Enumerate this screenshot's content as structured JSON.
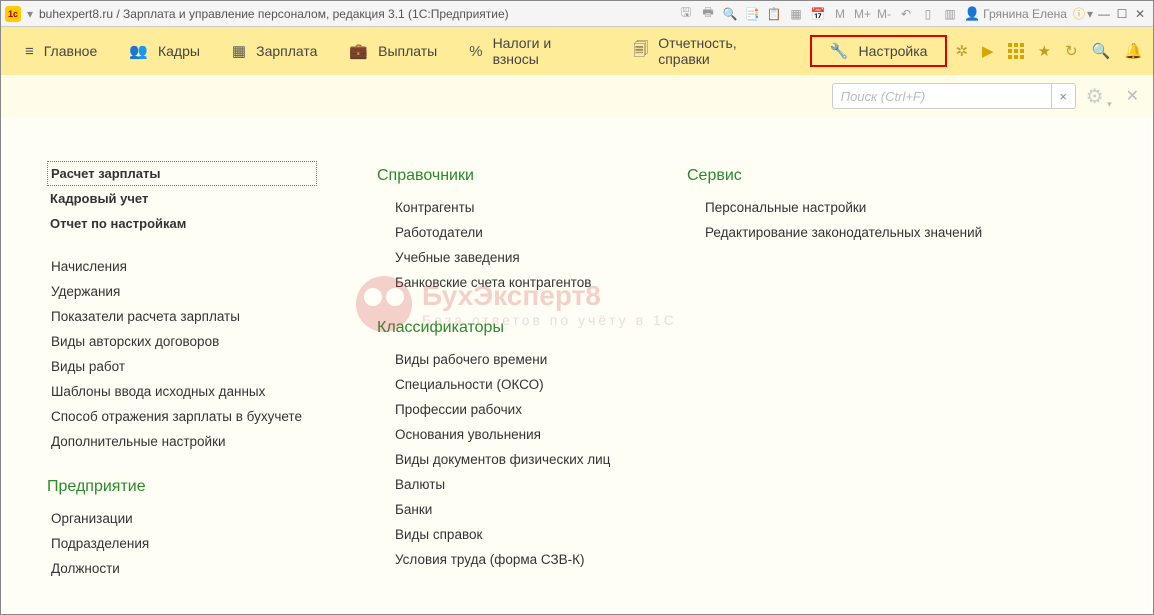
{
  "title": "buhexpert8.ru / Зарплата и управление персоналом, редакция 3.1  (1С:Предприятие)",
  "user": "Грянина Елена",
  "nav": [
    {
      "icon": "≡",
      "label": "Главное"
    },
    {
      "icon": "👥",
      "label": "Кадры"
    },
    {
      "icon": "▦",
      "label": "Зарплата"
    },
    {
      "icon": "💼",
      "label": "Выплаты"
    },
    {
      "icon": "%",
      "label": "Налоги и взносы"
    },
    {
      "icon": "🗐",
      "label": "Отчетность, справки"
    },
    {
      "icon": "🔧",
      "label": "Настройка"
    }
  ],
  "search_placeholder": "Поиск (Ctrl+F)",
  "col1": {
    "bold_links": [
      "Расчет зарплаты",
      "Кадровый учет",
      "Отчет по настройкам"
    ],
    "links": [
      "Начисления",
      "Удержания",
      "Показатели расчета зарплаты",
      "Виды авторских договоров",
      "Виды работ",
      "Шаблоны ввода исходных данных",
      "Способ отражения зарплаты в бухучете",
      "Дополнительные настройки"
    ],
    "section2": "Предприятие",
    "links2": [
      "Организации",
      "Подразделения",
      "Должности"
    ]
  },
  "col2": {
    "section1": "Справочники",
    "links1": [
      "Контрагенты",
      "Работодатели",
      "Учебные заведения",
      "Банковские счета контрагентов"
    ],
    "section2": "Классификаторы",
    "links2": [
      "Виды рабочего времени",
      "Специальности (ОКСО)",
      "Профессии рабочих",
      "Основания увольнения",
      "Виды документов физических лиц",
      "Валюты",
      "Банки",
      "Виды справок",
      "Условия труда (форма СЗВ-К)"
    ]
  },
  "col3": {
    "section": "Сервис",
    "links": [
      "Персональные настройки",
      "Редактирование законодательных значений"
    ]
  },
  "watermark": {
    "t1": "БухЭксперт8",
    "t2": "База ответов по учёту в 1С"
  }
}
